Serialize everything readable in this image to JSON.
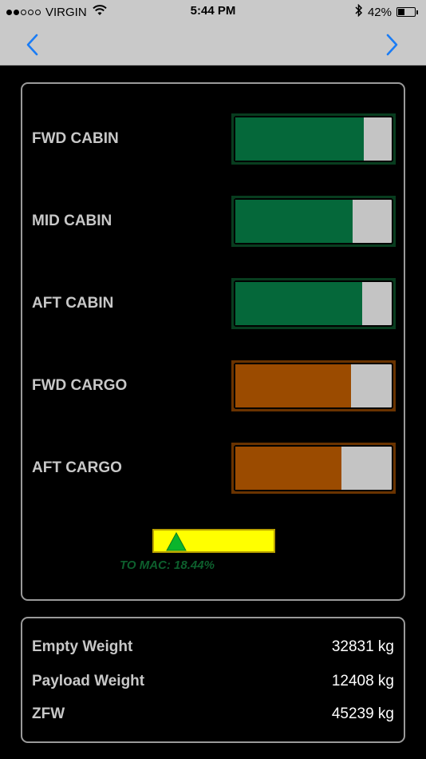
{
  "status": {
    "carrier": "VIRGIN",
    "signal_bars": [
      true,
      true,
      false,
      false,
      false
    ],
    "time": "5:44 PM",
    "battery_percent": "42%",
    "battery_level": 0.42
  },
  "nav": {
    "back_icon": "chevron-left-icon",
    "forward_icon": "chevron-right-icon",
    "accent": "#1a7cf5"
  },
  "compartments": [
    {
      "label": "FWD CABIN",
      "fill": 0.82,
      "fill_color": "#05683a",
      "frame_color": "#083d1f"
    },
    {
      "label": "MID CABIN",
      "fill": 0.75,
      "fill_color": "#05683a",
      "frame_color": "#083d1f"
    },
    {
      "label": "AFT CABIN",
      "fill": 0.81,
      "fill_color": "#05683a",
      "frame_color": "#083d1f"
    },
    {
      "label": "FWD CARGO",
      "fill": 0.74,
      "fill_color": "#9b4b00",
      "frame_color": "#6a3300"
    },
    {
      "label": "AFT CARGO",
      "fill": 0.68,
      "fill_color": "#9b4b00",
      "frame_color": "#6a3300"
    }
  ],
  "mac": {
    "label": "TO MAC: 18.44%",
    "value": 18.44,
    "gauge_color": "#ffff00",
    "marker_color": "#0bb52c"
  },
  "weights": [
    {
      "label": "Empty Weight",
      "value": "32831 kg"
    },
    {
      "label": "Payload Weight",
      "value": "12408 kg"
    },
    {
      "label": "ZFW",
      "value": "45239 kg"
    }
  ]
}
